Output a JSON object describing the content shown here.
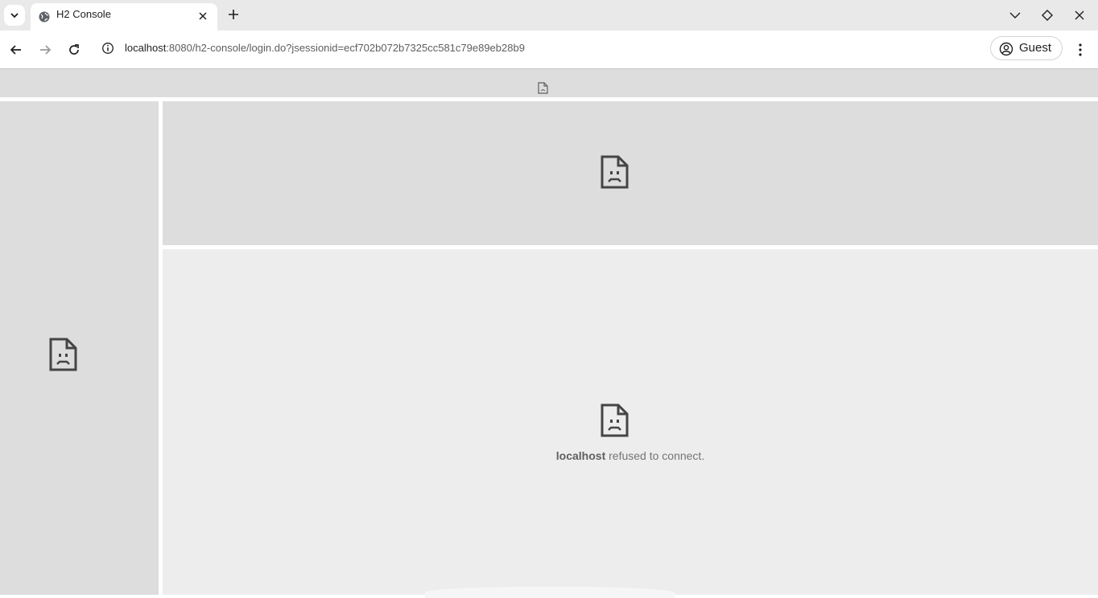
{
  "browser": {
    "tab": {
      "title": "H2 Console"
    },
    "address": {
      "host": "localhost",
      "rest": ":8080/h2-console/login.do?jsessionid=ecf702b072b7325cc581c79e89eb28b9"
    },
    "profile": {
      "label": "Guest"
    }
  },
  "content": {
    "error": {
      "host": "localhost",
      "message": " refused to connect."
    }
  },
  "icons": {
    "tab_search": "chevron-down-icon",
    "favicon": "globe-icon",
    "close": "close-icon",
    "new_tab": "plus-icon",
    "back": "arrow-left-icon",
    "forward": "arrow-right-icon",
    "reload": "reload-icon",
    "site_info": "info-icon",
    "profile": "user-circle-icon",
    "menu": "kebab-menu-icon",
    "sad_page": "sad-page-icon"
  },
  "colors": {
    "frame_bg": "#dddddd",
    "error_bg": "#ededed",
    "tabstrip_bg": "#e9e9e9",
    "text_muted": "#757575"
  }
}
